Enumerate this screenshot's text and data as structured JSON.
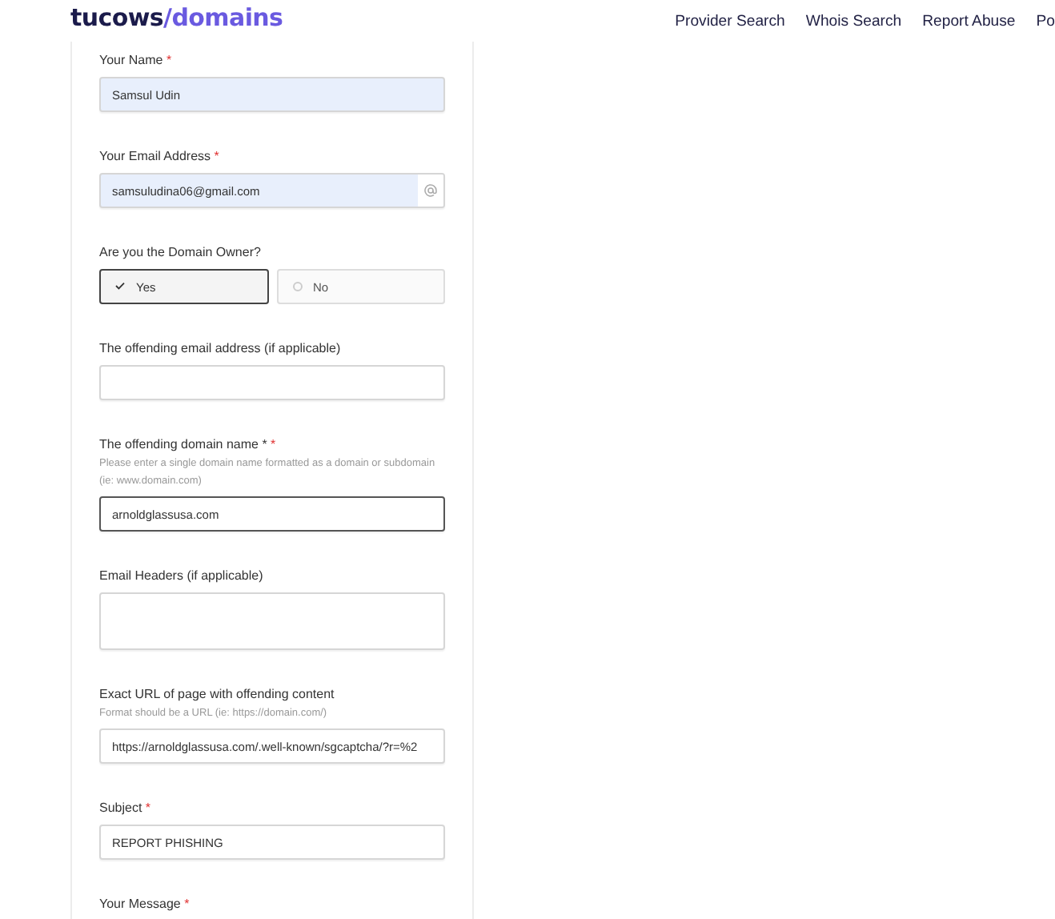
{
  "header": {
    "logo": {
      "brand": "tucows",
      "slash": "/",
      "product": "domains"
    },
    "nav": [
      {
        "label": "Provider Search"
      },
      {
        "label": "Whois Search"
      },
      {
        "label": "Report Abuse"
      },
      {
        "label": "Po"
      }
    ]
  },
  "form": {
    "fields": [
      {
        "kind": "text",
        "label": "Your Name",
        "mark": "*",
        "value": "Samsul Udin",
        "autofilled": true,
        "focused": false
      },
      {
        "kind": "email",
        "label": "Your Email Address",
        "mark": "*",
        "value": "samsuludina06@gmail.com",
        "autofilled": true,
        "focused": false
      },
      {
        "kind": "choice",
        "label": "Are you the Domain Owner?",
        "options": [
          {
            "label": "Yes",
            "selected": true
          },
          {
            "label": "No",
            "selected": false
          }
        ]
      },
      {
        "kind": "text",
        "label": "The offending email address (if applicable)",
        "autofilled": false,
        "focused": false
      },
      {
        "kind": "text",
        "label": "The offending domain name *",
        "mark": "*",
        "hint": "Please enter a single domain name formatted as a domain or subdomain (ie: www.domain.com)",
        "value": "arnoldglassusa.com",
        "autofilled": false,
        "focused": true
      },
      {
        "kind": "textarea",
        "label": "Email Headers (if applicable)"
      },
      {
        "kind": "text",
        "label": "Exact URL of page with offending content",
        "hint": "Format should be a URL (ie: https://domain.com/)",
        "value": "https://arnoldglassusa.com/.well-known/sgcaptcha/?r=%2",
        "autofilled": false,
        "focused": false
      },
      {
        "kind": "text",
        "label": "Subject",
        "mark": "*",
        "value": "REPORT PHISHING",
        "autofilled": false,
        "focused": false
      },
      {
        "kind": "partial",
        "label": "Your Message",
        "mark": "*"
      }
    ]
  }
}
